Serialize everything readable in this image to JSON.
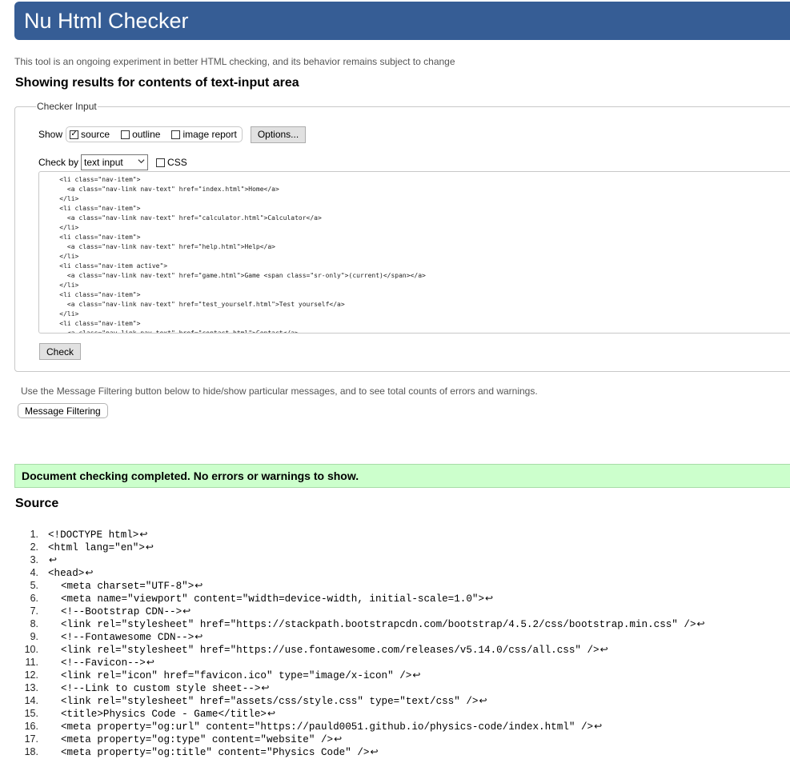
{
  "header": {
    "title": "Nu Html Checker"
  },
  "subtitle": "This tool is an ongoing experiment in better HTML checking, and its behavior remains subject to change",
  "results_heading": "Showing results for contents of text-input area",
  "checker": {
    "legend": "Checker Input",
    "show_label": "Show",
    "options": [
      {
        "label": "source",
        "checked": true
      },
      {
        "label": "outline",
        "checked": false
      },
      {
        "label": "image report",
        "checked": false
      }
    ],
    "options_button": "Options...",
    "checkby_label": "Check by",
    "checkby_value": "text input",
    "css_label": "CSS",
    "code": "    <li class=\"nav-item\">\n      <a class=\"nav-link nav-text\" href=\"index.html\">Home</a>\n    </li>\n    <li class=\"nav-item\">\n      <a class=\"nav-link nav-text\" href=\"calculator.html\">Calculator</a>\n    </li>\n    <li class=\"nav-item\">\n      <a class=\"nav-link nav-text\" href=\"help.html\">Help</a>\n    </li>\n    <li class=\"nav-item active\">\n      <a class=\"nav-link nav-text\" href=\"game.html\">Game <span class=\"sr-only\">(current)</span></a>\n    </li>\n    <li class=\"nav-item\">\n      <a class=\"nav-link nav-text\" href=\"test_yourself.html\">Test yourself</a>\n    </li>\n    <li class=\"nav-item\">\n      <a class=\"nav-link nav-text\" href=\"contact.html\">Contact</a>",
    "check_button": "Check"
  },
  "filter": {
    "note": "Use the Message Filtering button below to hide/show particular messages, and to see total counts of errors and warnings.",
    "button": "Message Filtering"
  },
  "status": "Document checking completed. No errors or warnings to show.",
  "source": {
    "heading": "Source",
    "return_glyph": "↩",
    "lines": [
      {
        "n": "1.",
        "indent": 0,
        "text": "<!DOCTYPE html>"
      },
      {
        "n": "2.",
        "indent": 0,
        "text": "<html lang=\"en\">"
      },
      {
        "n": "3.",
        "indent": 0,
        "text": ""
      },
      {
        "n": "4.",
        "indent": 0,
        "text": "<head>"
      },
      {
        "n": "5.",
        "indent": 1,
        "text": "<meta charset=\"UTF-8\">"
      },
      {
        "n": "6.",
        "indent": 1,
        "text": "<meta name=\"viewport\" content=\"width=device-width, initial-scale=1.0\">"
      },
      {
        "n": "7.",
        "indent": 1,
        "text": "<!--Bootstrap CDN-->"
      },
      {
        "n": "8.",
        "indent": 1,
        "text": "<link rel=\"stylesheet\" href=\"https://stackpath.bootstrapcdn.com/bootstrap/4.5.2/css/bootstrap.min.css\" />"
      },
      {
        "n": "9.",
        "indent": 1,
        "text": "<!--Fontawesome CDN-->"
      },
      {
        "n": "10.",
        "indent": 1,
        "text": "<link rel=\"stylesheet\" href=\"https://use.fontawesome.com/releases/v5.14.0/css/all.css\" />"
      },
      {
        "n": "11.",
        "indent": 1,
        "text": "<!--Favicon-->"
      },
      {
        "n": "12.",
        "indent": 1,
        "text": "<link rel=\"icon\" href=\"favicon.ico\" type=\"image/x-icon\" />"
      },
      {
        "n": "13.",
        "indent": 1,
        "text": "<!--Link to custom style sheet-->"
      },
      {
        "n": "14.",
        "indent": 1,
        "text": "<link rel=\"stylesheet\" href=\"assets/css/style.css\" type=\"text/css\" />"
      },
      {
        "n": "15.",
        "indent": 1,
        "text": "<title>Physics Code - Game</title>"
      },
      {
        "n": "16.",
        "indent": 1,
        "text": "<meta property=\"og:url\" content=\"https://pauld0051.github.io/physics-code/index.html\" />"
      },
      {
        "n": "17.",
        "indent": 1,
        "text": "<meta property=\"og:type\" content=\"website\" />"
      },
      {
        "n": "18.",
        "indent": 1,
        "text": "<meta property=\"og:title\" content=\"Physics Code\" />"
      }
    ]
  }
}
